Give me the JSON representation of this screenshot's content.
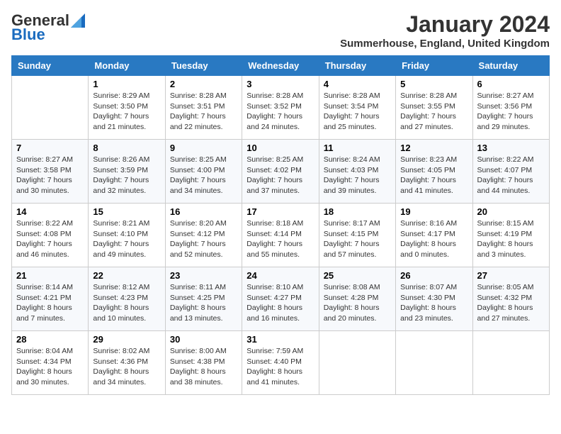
{
  "logo": {
    "general": "General",
    "blue": "Blue"
  },
  "title": "January 2024",
  "location": "Summerhouse, England, United Kingdom",
  "days_of_week": [
    "Sunday",
    "Monday",
    "Tuesday",
    "Wednesday",
    "Thursday",
    "Friday",
    "Saturday"
  ],
  "weeks": [
    [
      {
        "num": "",
        "info": ""
      },
      {
        "num": "1",
        "info": "Sunrise: 8:29 AM\nSunset: 3:50 PM\nDaylight: 7 hours\nand 21 minutes."
      },
      {
        "num": "2",
        "info": "Sunrise: 8:28 AM\nSunset: 3:51 PM\nDaylight: 7 hours\nand 22 minutes."
      },
      {
        "num": "3",
        "info": "Sunrise: 8:28 AM\nSunset: 3:52 PM\nDaylight: 7 hours\nand 24 minutes."
      },
      {
        "num": "4",
        "info": "Sunrise: 8:28 AM\nSunset: 3:54 PM\nDaylight: 7 hours\nand 25 minutes."
      },
      {
        "num": "5",
        "info": "Sunrise: 8:28 AM\nSunset: 3:55 PM\nDaylight: 7 hours\nand 27 minutes."
      },
      {
        "num": "6",
        "info": "Sunrise: 8:27 AM\nSunset: 3:56 PM\nDaylight: 7 hours\nand 29 minutes."
      }
    ],
    [
      {
        "num": "7",
        "info": "Sunrise: 8:27 AM\nSunset: 3:58 PM\nDaylight: 7 hours\nand 30 minutes."
      },
      {
        "num": "8",
        "info": "Sunrise: 8:26 AM\nSunset: 3:59 PM\nDaylight: 7 hours\nand 32 minutes."
      },
      {
        "num": "9",
        "info": "Sunrise: 8:25 AM\nSunset: 4:00 PM\nDaylight: 7 hours\nand 34 minutes."
      },
      {
        "num": "10",
        "info": "Sunrise: 8:25 AM\nSunset: 4:02 PM\nDaylight: 7 hours\nand 37 minutes."
      },
      {
        "num": "11",
        "info": "Sunrise: 8:24 AM\nSunset: 4:03 PM\nDaylight: 7 hours\nand 39 minutes."
      },
      {
        "num": "12",
        "info": "Sunrise: 8:23 AM\nSunset: 4:05 PM\nDaylight: 7 hours\nand 41 minutes."
      },
      {
        "num": "13",
        "info": "Sunrise: 8:22 AM\nSunset: 4:07 PM\nDaylight: 7 hours\nand 44 minutes."
      }
    ],
    [
      {
        "num": "14",
        "info": "Sunrise: 8:22 AM\nSunset: 4:08 PM\nDaylight: 7 hours\nand 46 minutes."
      },
      {
        "num": "15",
        "info": "Sunrise: 8:21 AM\nSunset: 4:10 PM\nDaylight: 7 hours\nand 49 minutes."
      },
      {
        "num": "16",
        "info": "Sunrise: 8:20 AM\nSunset: 4:12 PM\nDaylight: 7 hours\nand 52 minutes."
      },
      {
        "num": "17",
        "info": "Sunrise: 8:18 AM\nSunset: 4:14 PM\nDaylight: 7 hours\nand 55 minutes."
      },
      {
        "num": "18",
        "info": "Sunrise: 8:17 AM\nSunset: 4:15 PM\nDaylight: 7 hours\nand 57 minutes."
      },
      {
        "num": "19",
        "info": "Sunrise: 8:16 AM\nSunset: 4:17 PM\nDaylight: 8 hours\nand 0 minutes."
      },
      {
        "num": "20",
        "info": "Sunrise: 8:15 AM\nSunset: 4:19 PM\nDaylight: 8 hours\nand 3 minutes."
      }
    ],
    [
      {
        "num": "21",
        "info": "Sunrise: 8:14 AM\nSunset: 4:21 PM\nDaylight: 8 hours\nand 7 minutes."
      },
      {
        "num": "22",
        "info": "Sunrise: 8:12 AM\nSunset: 4:23 PM\nDaylight: 8 hours\nand 10 minutes."
      },
      {
        "num": "23",
        "info": "Sunrise: 8:11 AM\nSunset: 4:25 PM\nDaylight: 8 hours\nand 13 minutes."
      },
      {
        "num": "24",
        "info": "Sunrise: 8:10 AM\nSunset: 4:27 PM\nDaylight: 8 hours\nand 16 minutes."
      },
      {
        "num": "25",
        "info": "Sunrise: 8:08 AM\nSunset: 4:28 PM\nDaylight: 8 hours\nand 20 minutes."
      },
      {
        "num": "26",
        "info": "Sunrise: 8:07 AM\nSunset: 4:30 PM\nDaylight: 8 hours\nand 23 minutes."
      },
      {
        "num": "27",
        "info": "Sunrise: 8:05 AM\nSunset: 4:32 PM\nDaylight: 8 hours\nand 27 minutes."
      }
    ],
    [
      {
        "num": "28",
        "info": "Sunrise: 8:04 AM\nSunset: 4:34 PM\nDaylight: 8 hours\nand 30 minutes."
      },
      {
        "num": "29",
        "info": "Sunrise: 8:02 AM\nSunset: 4:36 PM\nDaylight: 8 hours\nand 34 minutes."
      },
      {
        "num": "30",
        "info": "Sunrise: 8:00 AM\nSunset: 4:38 PM\nDaylight: 8 hours\nand 38 minutes."
      },
      {
        "num": "31",
        "info": "Sunrise: 7:59 AM\nSunset: 4:40 PM\nDaylight: 8 hours\nand 41 minutes."
      },
      {
        "num": "",
        "info": ""
      },
      {
        "num": "",
        "info": ""
      },
      {
        "num": "",
        "info": ""
      }
    ]
  ]
}
